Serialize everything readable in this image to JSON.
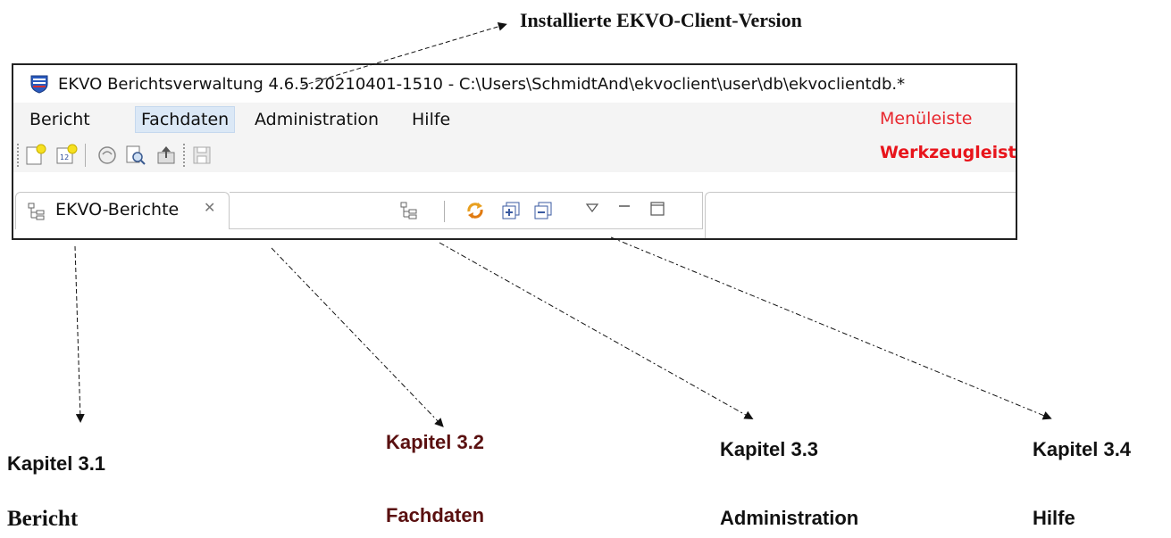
{
  "annotations": {
    "version_caption": "Installierte EKVO-Client-Version",
    "menubar_caption": "Menüleiste",
    "toolbar_caption": "Werkzeugleiste",
    "chapters": [
      {
        "chapter": "Kapitel 3.1",
        "name": "Bericht"
      },
      {
        "chapter": "Kapitel 3.2",
        "name": "Fachdaten"
      },
      {
        "chapter": "Kapitel 3.3",
        "name": "Administration"
      },
      {
        "chapter": "Kapitel 3.4",
        "name": "Hilfe"
      }
    ]
  },
  "window": {
    "title": "EKVO Berichtsverwaltung 4.6.5.20210401-1510 - C:\\Users\\SchmidtAnd\\ekvoclient\\user\\db\\ekvoclientdb.*"
  },
  "menu": {
    "items": [
      "Bericht",
      "Fachdaten",
      "Administration",
      "Hilfe"
    ],
    "active": "Fachdaten"
  },
  "toolbar": {
    "icons": [
      "new-report-icon",
      "calendar-report-icon",
      "open-report-icon",
      "preview-icon",
      "upload-icon",
      "save-icon"
    ]
  },
  "view": {
    "tab_label": "EKVO-Berichte",
    "tab_close_glyph": "✕",
    "view_icons": [
      "tree-view-icon",
      "sync-icon",
      "expand-all-icon",
      "collapse-all-icon",
      "view-menu-icon",
      "minimize-icon",
      "maximize-icon"
    ]
  },
  "colors": {
    "menubar_caption": "#e8282f",
    "toolbar_caption": "#e8141b",
    "active_menu_bg": "#dbe8f6",
    "chapter_dark_red": "#5a1010"
  }
}
